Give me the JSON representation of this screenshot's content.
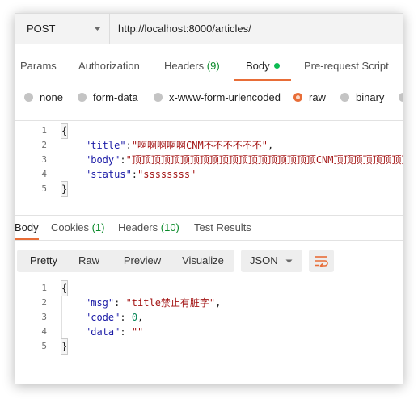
{
  "request": {
    "method": "POST",
    "url": "http://localhost:8000/articles/",
    "tabs": [
      {
        "label": "Params"
      },
      {
        "label": "Authorization"
      },
      {
        "label": "Headers",
        "count": "(9)"
      },
      {
        "label": "Body"
      },
      {
        "label": "Pre-request Script"
      }
    ],
    "body_types": [
      "none",
      "form-data",
      "x-www-form-urlencoded",
      "raw",
      "binary"
    ],
    "selected_body_type": "raw",
    "body_lines": [
      {
        "num": "1",
        "text": "{"
      },
      {
        "num": "2",
        "key": "\"title\"",
        "sep": ":",
        "val": "\"啊啊啊啊啊CNM不不不不不不\"",
        "end": ","
      },
      {
        "num": "3",
        "key": "\"body\"",
        "sep": ":",
        "val": "\"顶顶顶顶顶顶顶顶顶顶顶顶顶顶顶顶顶顶顶CNM顶顶顶顶顶顶顶顶顶",
        "end": ""
      },
      {
        "num": "4",
        "key": "\"status\"",
        "sep": ":",
        "val": "\"ssssssss\"",
        "end": ""
      },
      {
        "num": "5",
        "text": "}"
      }
    ]
  },
  "response": {
    "tabs": [
      {
        "label": "Body"
      },
      {
        "label": "Cookies",
        "count": "(1)"
      },
      {
        "label": "Headers",
        "count": "(10)"
      },
      {
        "label": "Test Results"
      }
    ],
    "view_modes": [
      "Pretty",
      "Raw",
      "Preview",
      "Visualize"
    ],
    "active_view_mode": "Pretty",
    "format": "JSON",
    "body_lines": [
      {
        "num": "1",
        "text": "{"
      },
      {
        "num": "2",
        "key": "\"msg\"",
        "sep": ": ",
        "val": "\"title禁止有脏字\"",
        "end": ","
      },
      {
        "num": "3",
        "key": "\"code\"",
        "sep": ": ",
        "val": "0",
        "end": ","
      },
      {
        "num": "4",
        "key": "\"data\"",
        "sep": ": ",
        "val": "\"\"",
        "end": ""
      },
      {
        "num": "5",
        "text": "}"
      }
    ]
  },
  "colors": {
    "accent": "#e86d37",
    "body_dot": "#0cbb52",
    "count_green": "#0a8a2a",
    "json_key": "#1a1aa6",
    "json_string": "#a31515"
  },
  "icons": {
    "method_dropdown": "chevron-down-icon",
    "format_dropdown": "chevron-down-icon",
    "wrap": "wrap-lines-icon"
  }
}
